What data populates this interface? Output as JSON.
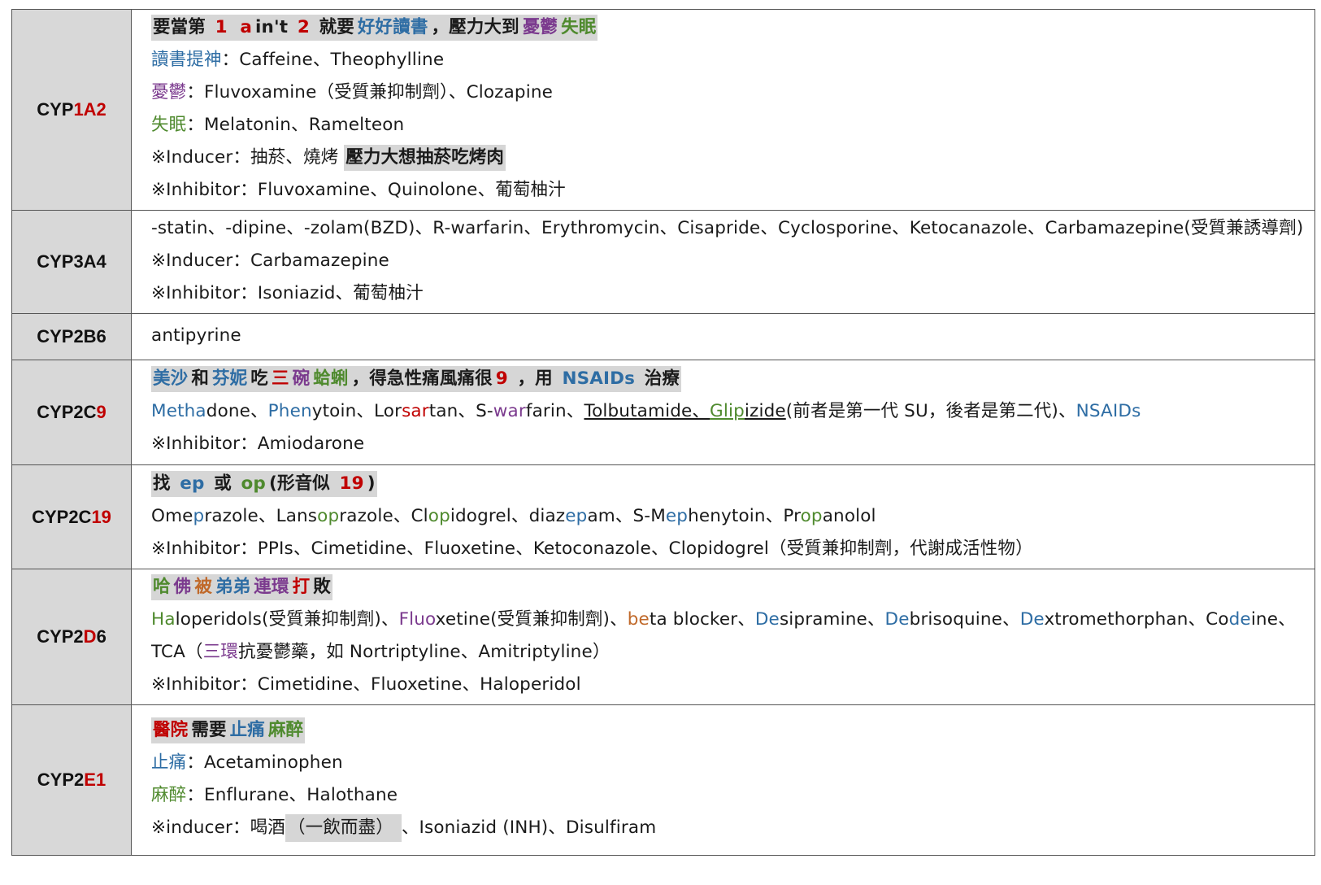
{
  "rows": [
    {
      "enzyme": [
        {
          "t": "CYP"
        },
        {
          "t": "1A2",
          "c": "r"
        }
      ],
      "lines": [
        [
          {
            "t": "要當第 ",
            "s": "hl"
          },
          {
            "t": "1",
            "s": "hl",
            "c": "r"
          },
          {
            "t": " ",
            "s": "hl"
          },
          {
            "t": "a",
            "s": "hl",
            "c": "r"
          },
          {
            "t": "in't ",
            "s": "hl"
          },
          {
            "t": "2",
            "s": "hl",
            "c": "r"
          },
          {
            "t": "  就要",
            "s": "hl"
          },
          {
            "t": "好好讀書",
            "s": "hl",
            "c": "b"
          },
          {
            "t": "，壓力大到",
            "s": "hl"
          },
          {
            "t": "憂鬱",
            "s": "hl",
            "c": "p"
          },
          {
            "t": "失眠",
            "s": "hl",
            "c": "g"
          }
        ],
        [
          {
            "t": "讀書提神",
            "c": "b"
          },
          {
            "t": "：Caffeine、Theophylline"
          }
        ],
        [
          {
            "t": "憂鬱",
            "c": "p"
          },
          {
            "t": "：Fluvoxamine（受質兼抑制劑）、Clozapine"
          }
        ],
        [
          {
            "t": "失眠",
            "c": "g"
          },
          {
            "t": "：Melatonin、Ramelteon"
          }
        ],
        [
          {
            "t": "※Inducer：抽菸、燒烤  "
          },
          {
            "t": "壓力大想抽菸吃烤肉",
            "s": "hl"
          }
        ],
        [
          {
            "t": "※Inhibitor：Fluvoxamine、Quinolone、葡萄柚汁"
          }
        ]
      ]
    },
    {
      "enzyme": [
        {
          "t": "CYP3A4"
        }
      ],
      "lines": [
        [
          {
            "t": "-statin、-dipine、-zolam(BZD)、R-warfarin、Erythromycin、Cisapride、Cyclosporine、Ketocanazole、Carbamazepine(受質兼誘導劑)"
          }
        ],
        [
          {
            "t": "※Inducer：Carbamazepine"
          }
        ],
        [
          {
            "t": "※Inhibitor：Isoniazid、葡萄柚汁"
          }
        ]
      ]
    },
    {
      "enzyme": [
        {
          "t": "CYP2B6"
        }
      ],
      "lines": [
        [
          {
            "t": "antipyrine"
          }
        ]
      ]
    },
    {
      "enzyme": [
        {
          "t": "CYP2C"
        },
        {
          "t": "9",
          "c": "r"
        }
      ],
      "lines": [
        [
          {
            "t": "美沙",
            "s": "hl",
            "c": "b"
          },
          {
            "t": "和",
            "s": "hl"
          },
          {
            "t": "芬妮",
            "s": "hl",
            "c": "b"
          },
          {
            "t": "吃",
            "s": "hl"
          },
          {
            "t": "三",
            "s": "hl",
            "c": "r"
          },
          {
            "t": "碗",
            "s": "hl",
            "c": "p"
          },
          {
            "t": "蛤蜊",
            "s": "hl",
            "c": "g"
          },
          {
            "t": "，得急性痛風痛很",
            "s": "hl"
          },
          {
            "t": "9",
            "s": "hl",
            "c": "r"
          },
          {
            "t": " ，用 ",
            "s": "hl"
          },
          {
            "t": "NSAIDs",
            "s": "hl",
            "c": "b"
          },
          {
            "t": " 治療",
            "s": "hl"
          }
        ],
        [
          {
            "t": "Metha",
            "c": "b"
          },
          {
            "t": "done、"
          },
          {
            "t": "Phen",
            "c": "b"
          },
          {
            "t": "ytoin、Lor"
          },
          {
            "t": "sar",
            "c": "r"
          },
          {
            "t": "tan、S-"
          },
          {
            "t": "war",
            "c": "p"
          },
          {
            "t": "farin、"
          },
          {
            "t": "Tolbutamide、",
            "s": "ul"
          },
          {
            "t": "Glip",
            "s": "ul",
            "c": "g"
          },
          {
            "t": "izide",
            "s": "ul"
          },
          {
            "t": "(前者是第一代 SU，後者是第二代)、"
          },
          {
            "t": "NSAIDs",
            "c": "b"
          }
        ],
        [
          {
            "t": "※Inhibitor：Amiodarone"
          }
        ]
      ]
    },
    {
      "enzyme": [
        {
          "t": "CYP2C"
        },
        {
          "t": "19",
          "c": "r"
        }
      ],
      "lines": [
        [
          {
            "t": "找 ",
            "s": "hl"
          },
          {
            "t": "ep",
            "s": "hl",
            "c": "b"
          },
          {
            "t": " 或 ",
            "s": "hl"
          },
          {
            "t": "op",
            "s": "hl",
            "c": "g"
          },
          {
            "t": "(形音似 ",
            "s": "hl"
          },
          {
            "t": "19",
            "s": "hl",
            "c": "r"
          },
          {
            "t": ")",
            "s": "hl"
          }
        ],
        [
          {
            "t": "Ome"
          },
          {
            "t": "p",
            "c": "b"
          },
          {
            "t": "razole、Lans"
          },
          {
            "t": "op",
            "c": "g"
          },
          {
            "t": "razole、Cl"
          },
          {
            "t": "op",
            "c": "g"
          },
          {
            "t": "idogrel、diaz"
          },
          {
            "t": "ep",
            "c": "b"
          },
          {
            "t": "am、S-M"
          },
          {
            "t": "ep",
            "c": "b"
          },
          {
            "t": "henytoin、Pr"
          },
          {
            "t": "op",
            "c": "g"
          },
          {
            "t": "anolol"
          }
        ],
        [
          {
            "t": "※Inhibitor：PPIs、Cimetidine、Fluoxetine、Ketoconazole、Clopidogrel（受質兼抑制劑，代謝成活性物）"
          }
        ]
      ]
    },
    {
      "enzyme": [
        {
          "t": "CYP2"
        },
        {
          "t": "D",
          "c": "r"
        },
        {
          "t": "6"
        }
      ],
      "lines": [
        [
          {
            "t": "哈",
            "s": "hl",
            "c": "g"
          },
          {
            "t": "佛",
            "s": "hl",
            "c": "p"
          },
          {
            "t": "被",
            "s": "hl",
            "c": "o"
          },
          {
            "t": "弟弟",
            "s": "hl",
            "c": "b"
          },
          {
            "t": "連環",
            "s": "hl",
            "c": "p"
          },
          {
            "t": "打",
            "s": "hl",
            "c": "r"
          },
          {
            "t": "敗",
            "s": "hl"
          }
        ],
        [
          {
            "t": "Ha",
            "c": "g"
          },
          {
            "t": "loperidols(受質兼抑制劑)、"
          },
          {
            "t": "Fluo",
            "c": "p"
          },
          {
            "t": "xetine(受質兼抑制劑)、"
          },
          {
            "t": "be",
            "c": "o"
          },
          {
            "t": "ta blocker、"
          },
          {
            "t": "De",
            "c": "b"
          },
          {
            "t": "sipramine、"
          },
          {
            "t": "De",
            "c": "b"
          },
          {
            "t": "brisoquine、"
          },
          {
            "t": "De",
            "c": "b"
          },
          {
            "t": "xtromethorphan、Co"
          },
          {
            "t": "de",
            "c": "b"
          },
          {
            "t": "ine、"
          }
        ],
        [
          {
            "t": "TCA（"
          },
          {
            "t": "三環",
            "c": "p"
          },
          {
            "t": "抗憂鬱藥，如 Nortriptyline、Amitriptyline）"
          }
        ],
        [
          {
            "t": "※Inhibitor：Cimetidine、Fluoxetine、Haloperidol"
          }
        ]
      ]
    },
    {
      "enzyme": [
        {
          "t": "CYP2"
        },
        {
          "t": "E1",
          "c": "r"
        }
      ],
      "lines": [
        [
          {
            "t": "醫院",
            "s": "hl",
            "c": "r"
          },
          {
            "t": "需要",
            "s": "hl"
          },
          {
            "t": "止痛",
            "s": "hl",
            "c": "b"
          },
          {
            "t": "麻醉",
            "s": "hl",
            "c": "g"
          }
        ],
        [
          {
            "t": "止痛",
            "c": "b"
          },
          {
            "t": "：Acetaminophen"
          }
        ],
        [
          {
            "t": "麻醉",
            "c": "g"
          },
          {
            "t": "：Enflurane、Halothane"
          }
        ],
        [
          {
            "t": "※inducer：喝酒"
          },
          {
            "t": "（一飲而盡）  ",
            "s": "hlp"
          },
          {
            "t": " 、Isoniazid (INH)、Disulfiram"
          }
        ]
      ]
    }
  ]
}
